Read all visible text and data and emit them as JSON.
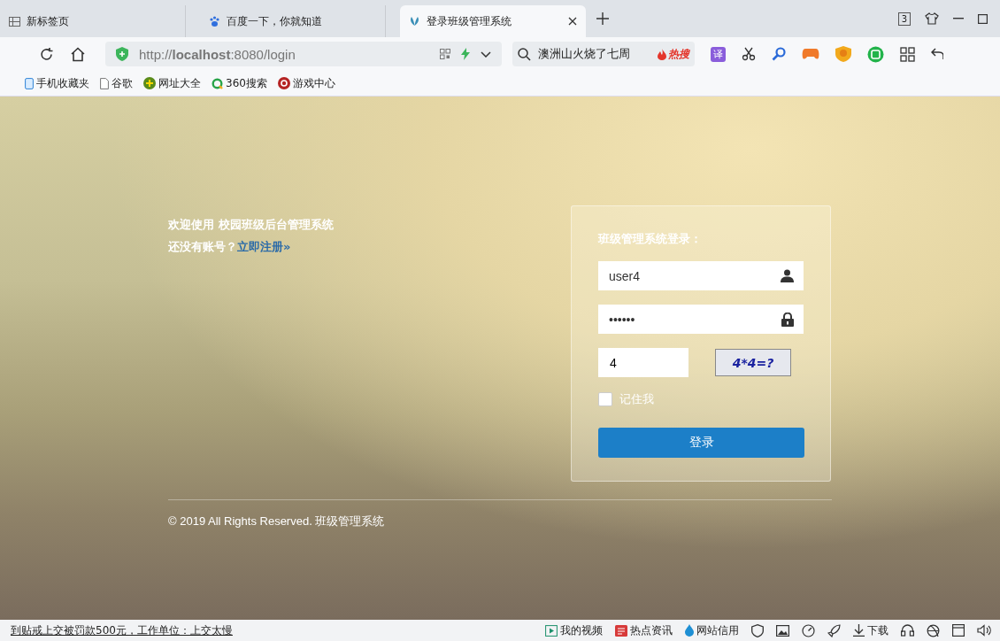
{
  "browser": {
    "tabs": [
      {
        "title": "新标签页",
        "selected": false
      },
      {
        "title": "百度一下，你就知道",
        "selected": false
      },
      {
        "title": "登录班级管理系统",
        "selected": true
      }
    ],
    "tab_count": "3",
    "address": "http://**localhost**:8080/login",
    "search": {
      "value": "澳洲山火烧了七周",
      "hot_badge": "热搜"
    },
    "translate": "译",
    "bookmarks": [
      {
        "label": "手机收藏夹"
      },
      {
        "label": "谷歌"
      },
      {
        "label": "网址大全"
      },
      {
        "label": "360搜索"
      },
      {
        "label": "游戏中心"
      }
    ]
  },
  "page": {
    "welcome": "欢迎使用 校园班级后台管理系统",
    "no_account": "还没有账号？",
    "register_link": "立即注册»",
    "login": {
      "title": "班级管理系统登录：",
      "username": "user4",
      "password": "••••••",
      "captcha_value": "4",
      "captcha_image_text": "4*4=?",
      "remember": {
        "label": "记住我",
        "checked": false
      },
      "submit": "登录"
    },
    "footer": "© 2019 All Rights Reserved. 班级管理系统"
  },
  "status_bar": {
    "news": "到贴戒上交被罚款500元，工作单位：上交太慢",
    "items": [
      {
        "label": "我的视频"
      },
      {
        "label": "热点资讯"
      },
      {
        "label": "网站信用"
      }
    ],
    "download": "下载"
  }
}
